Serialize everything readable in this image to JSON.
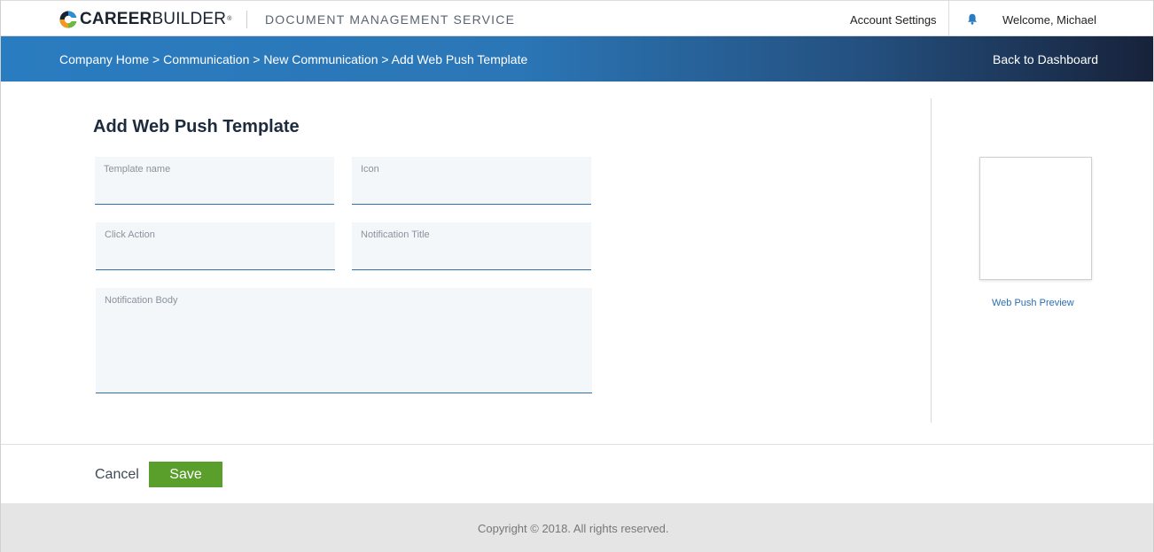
{
  "header": {
    "logo_bold": "CAREER",
    "logo_light": "BUILDER",
    "logo_reg": "®",
    "service_title": "DOCUMENT MANAGEMENT SERVICE",
    "account_settings": "Account Settings",
    "welcome": "Welcome, Michael"
  },
  "nav": {
    "breadcrumb": "Company Home > Communication > New Communication > Add Web Push Template",
    "back_link": "Back to Dashboard"
  },
  "form": {
    "title": "Add Web Push Template",
    "fields": {
      "template_name": "Template name",
      "icon": "Icon",
      "click_action": "Click Action",
      "notification_title": "Notification Title",
      "notification_body": "Notification Body"
    }
  },
  "preview": {
    "label": "Web Push Preview"
  },
  "actions": {
    "cancel": "Cancel",
    "save": "Save"
  },
  "footer": {
    "copyright": "Copyright © 2018. All rights reserved."
  },
  "colors": {
    "accent_blue": "#2a7cc0",
    "band_dark": "#17223a",
    "save_green": "#5a9e2c",
    "link_blue": "#2a6fb5"
  }
}
